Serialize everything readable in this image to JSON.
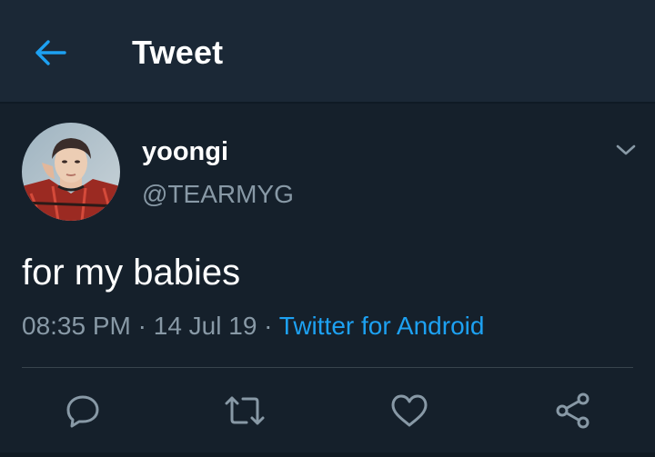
{
  "header": {
    "back_icon": "arrow-left-icon",
    "title": "Tweet"
  },
  "tweet": {
    "display_name": "yoongi",
    "handle": "@TEARMYG",
    "text": "for my babies",
    "time": "08:35 PM",
    "separator": "·",
    "date": "14 Jul 19",
    "source": "Twitter for Android",
    "menu_icon": "chevron-down-icon"
  },
  "actions": [
    {
      "icon": "reply-icon"
    },
    {
      "icon": "retweet-icon"
    },
    {
      "icon": "like-icon"
    },
    {
      "icon": "share-icon"
    }
  ],
  "colors": {
    "background": "#15202b",
    "header": "#1b2836",
    "accent": "#1da1f2",
    "muted_text": "#8899a6",
    "divider": "#38444d"
  }
}
